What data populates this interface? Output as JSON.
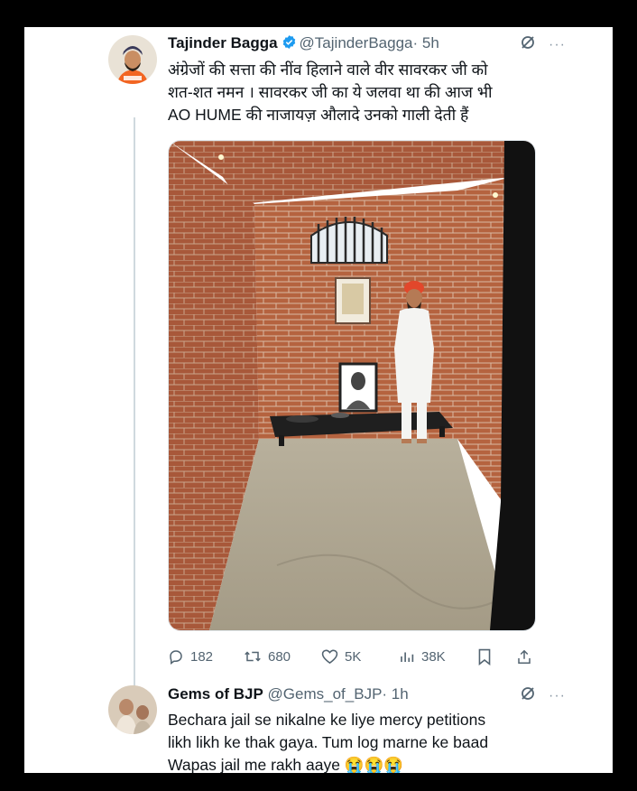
{
  "tweet1": {
    "author_name": "Tajinder Bagga",
    "handle": "@TajinderBagga",
    "time": "· 5h",
    "text": "अंग्रेजों की सत्ता की नींव हिलाने वाले वीर सावरकर जी को\nशत-शत नमन । सावरकर जी का ये जलवा था की आज भी\nAO HUME की नाजायज़ औलादे उनको गाली देती हैं",
    "counts": {
      "replies": "182",
      "retweets": "680",
      "likes": "5K",
      "views": "38K"
    }
  },
  "tweet2": {
    "author_name": "Gems of BJP",
    "handle": "@Gems_of_BJP",
    "time": "· 1h",
    "text": "Bechara jail se nikalne ke liye mercy petitions\nlikh likh ke thak gaya.  Tum log marne ke baad\nWapas jail me rakh aaye 😭😭😭"
  },
  "icons": [
    "verified-badge-icon",
    "grok-icon",
    "more-icon",
    "reply-icon",
    "retweet-icon",
    "like-icon",
    "views-icon",
    "bookmark-icon",
    "share-icon"
  ],
  "colors": {
    "verified": "#1d9bf0",
    "secondary_text": "#536471",
    "brick": "#b0603c"
  }
}
